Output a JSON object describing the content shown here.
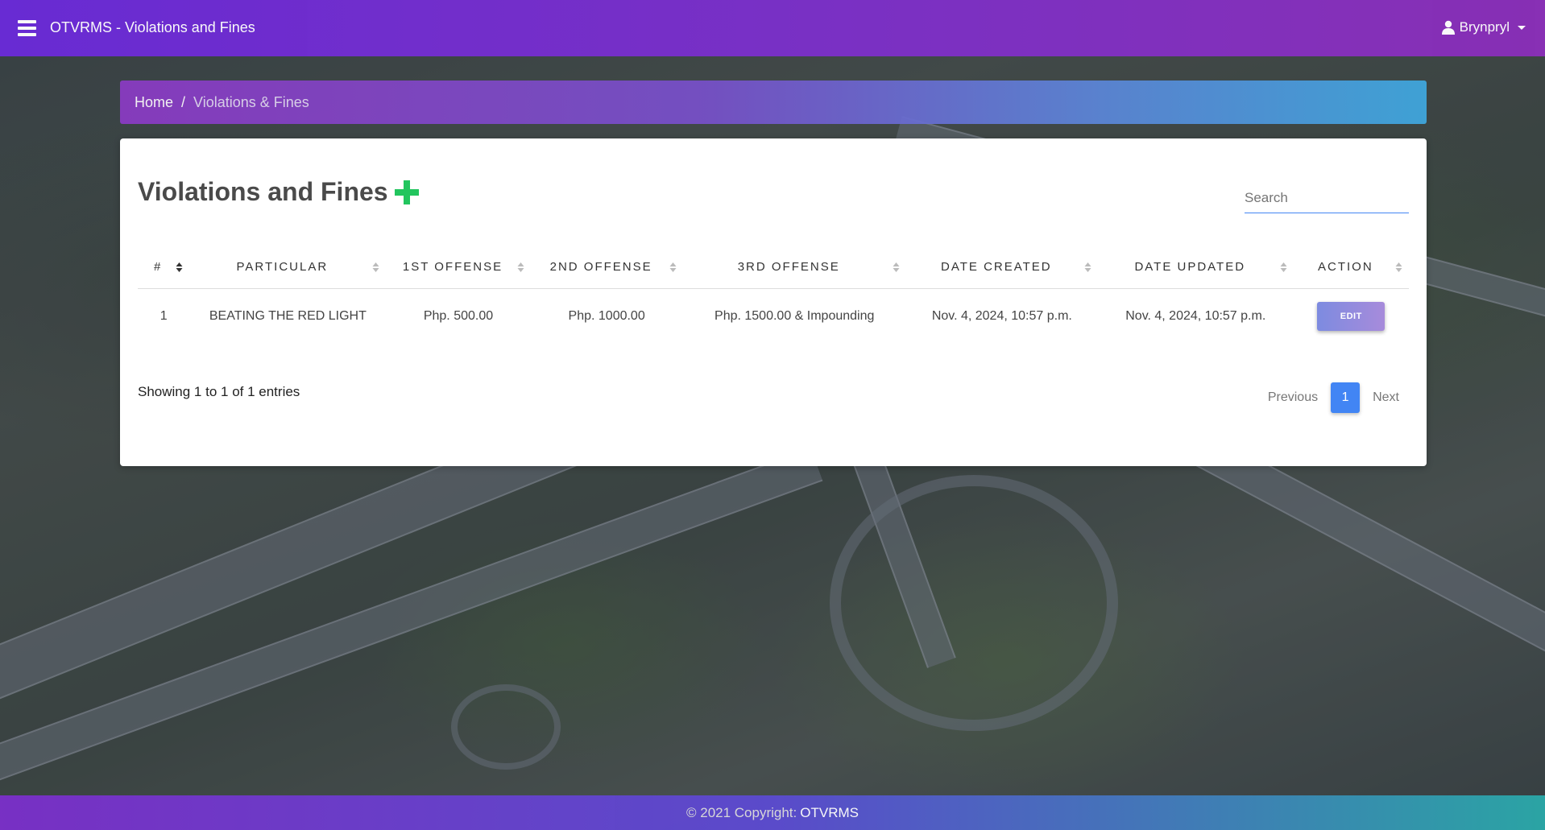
{
  "navbar": {
    "brand": "OTVRMS - Violations and Fines",
    "user": "Brynpryl"
  },
  "breadcrumb": {
    "home": "Home",
    "separator": "/",
    "current": "Violations & Fines"
  },
  "card": {
    "title": "Violations and Fines",
    "search_placeholder": "Search"
  },
  "table": {
    "headers": [
      "#",
      "PARTICULAR",
      "1ST OFFENSE",
      "2ND OFFENSE",
      "3RD OFFENSE",
      "DATE CREATED",
      "DATE UPDATED",
      "ACTION"
    ],
    "rows": [
      {
        "num": "1",
        "particular": "BEATING THE RED LIGHT",
        "first": "Php. 500.00",
        "second": "Php. 1000.00",
        "third": "Php. 1500.00 & Impounding",
        "created": "Nov. 4, 2024, 10:57 p.m.",
        "updated": "Nov. 4, 2024, 10:57 p.m.",
        "action": "EDIT"
      }
    ]
  },
  "info": "Showing 1 to 1 of 1 entries",
  "pagination": {
    "previous": "Previous",
    "current": "1",
    "next": "Next"
  },
  "footer": {
    "text": "© 2021 Copyright:",
    "brand": "OTVRMS"
  },
  "colors": {
    "navbar": "#6a2bd8",
    "accent_blue": "#4285f4",
    "add_green": "#22c55e"
  }
}
